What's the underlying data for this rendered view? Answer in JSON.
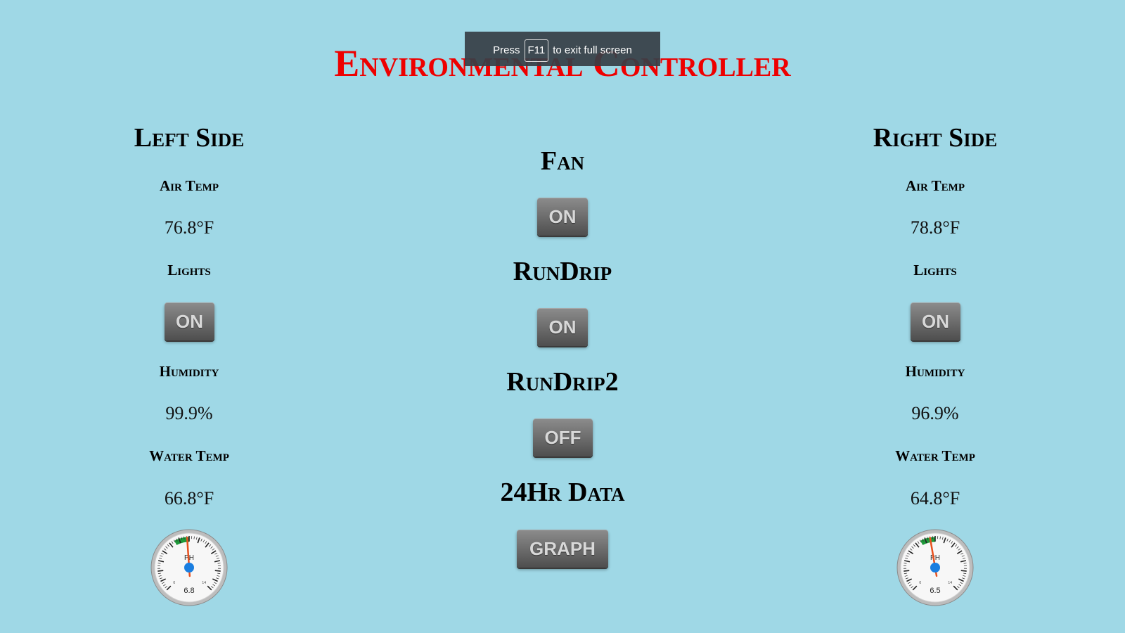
{
  "title": "Environmental Controller",
  "fullscreen_notice": {
    "prefix": "Press",
    "key": "F11",
    "suffix": "to exit full screen"
  },
  "left": {
    "heading": "Left Side",
    "air_temp_label": "Air Temp",
    "air_temp_value": "76.8°F",
    "lights_label": "Lights",
    "lights_button": "ON",
    "humidity_label": "Humidity",
    "humidity_value": "99.9%",
    "water_temp_label": "Water Temp",
    "water_temp_value": "66.8°F",
    "ph_gauge": {
      "label": "PH",
      "value": "6.8",
      "reading": 6.8,
      "min_label": "0",
      "max_label": "14"
    }
  },
  "center": {
    "fan_label": "Fan",
    "fan_button": "ON",
    "rundrip_label": "RunDrip",
    "rundrip_button": "ON",
    "rundrip2_label": "RunDrip2",
    "rundrip2_button": "OFF",
    "data_label": "24Hr Data",
    "graph_button": "GRAPH"
  },
  "right": {
    "heading": "Right Side",
    "air_temp_label": "Air Temp",
    "air_temp_value": "78.8°F",
    "lights_label": "Lights",
    "lights_button": "ON",
    "humidity_label": "Humidity",
    "humidity_value": "96.9%",
    "water_temp_label": "Water Temp",
    "water_temp_value": "64.8°F",
    "ph_gauge": {
      "label": "PH",
      "value": "6.5",
      "reading": 6.5,
      "min_label": "0",
      "max_label": "14"
    }
  },
  "colors": {
    "background": "#9fd8e6",
    "title": "#ee0000",
    "gauge_green_band": "#1e9a3a",
    "gauge_needle": "#e8501e",
    "gauge_hub": "#1a7ee0"
  }
}
